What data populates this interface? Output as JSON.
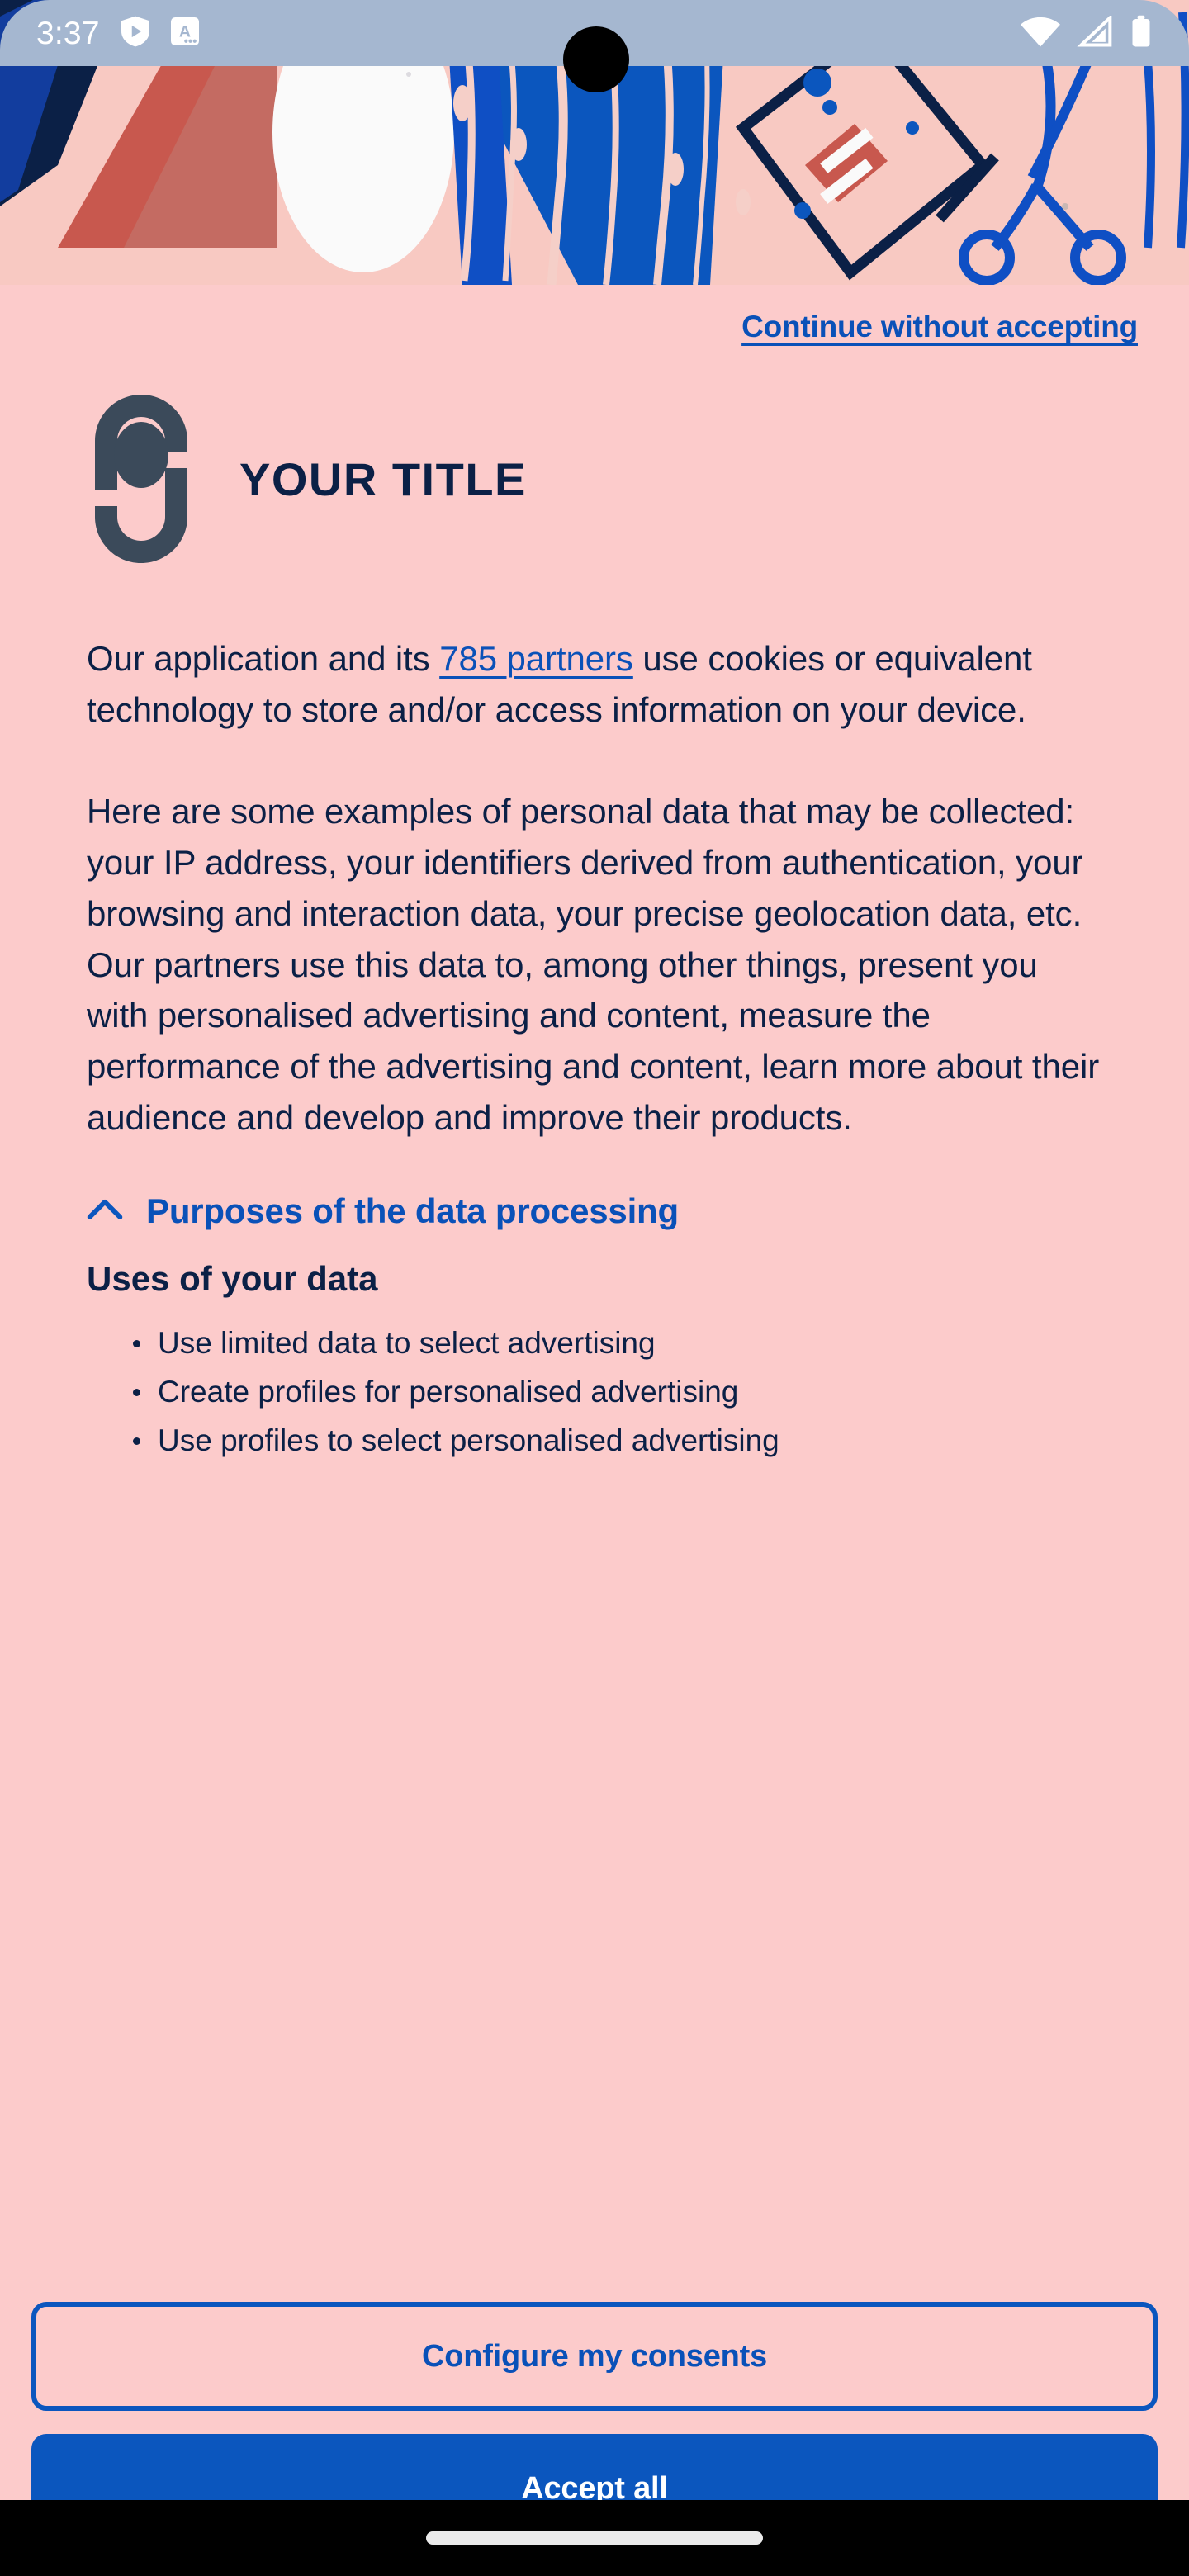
{
  "statusbar": {
    "time": "3:37",
    "icons": [
      "play-protect-shield-icon",
      "translate-a-icon",
      "wifi-icon",
      "cellular-signal-icon",
      "battery-icon"
    ]
  },
  "hero": {
    "alt": "abstract illustration with red triangle, white ellipse, blue brush strokes, envelope and scissors",
    "colors": {
      "pink": "#F8C9C2",
      "blue": "#0B56BE",
      "navy": "#0B2046",
      "red": "#C8584E",
      "white": "#FAFAFA"
    }
  },
  "dialog": {
    "continue_without_accepting": "Continue without accepting",
    "title": "YOUR TITLE",
    "paragraph1_before": "Our application and its ",
    "paragraph1_link": "785 partners",
    "paragraph1_after": " use cookies or equivalent technology to store and/or access information on your device.",
    "paragraph2": "Here are some examples of personal data that may be collected: your IP address, your identifiers derived from authentication, your browsing and interaction data, your precise geolocation data, etc.\nOur partners use this data to, among other things, present you with personalised advertising and content, measure the performance of the advertising and content, learn more about their audience and develop and improve their products.",
    "accordion": {
      "label": "Purposes of the data processing",
      "state": "expanded",
      "chevron": "chevron-up-icon"
    },
    "subsection": {
      "heading": "Uses of your data",
      "bullets": [
        "Use limited data to select advertising",
        "Create profiles for personalised advertising",
        "Use profiles to select personalised advertising"
      ]
    },
    "buttons": {
      "configure": "Configure my consents",
      "accept": "Accept all"
    }
  },
  "theme": {
    "background": "#FCCBCB",
    "accent_blue": "#0B56BE",
    "link_blue": "#0A51B8",
    "text_navy": "#0B2046",
    "logo_slate": "#3B4A5A",
    "statusbar_bg": "#A5B7D0"
  }
}
